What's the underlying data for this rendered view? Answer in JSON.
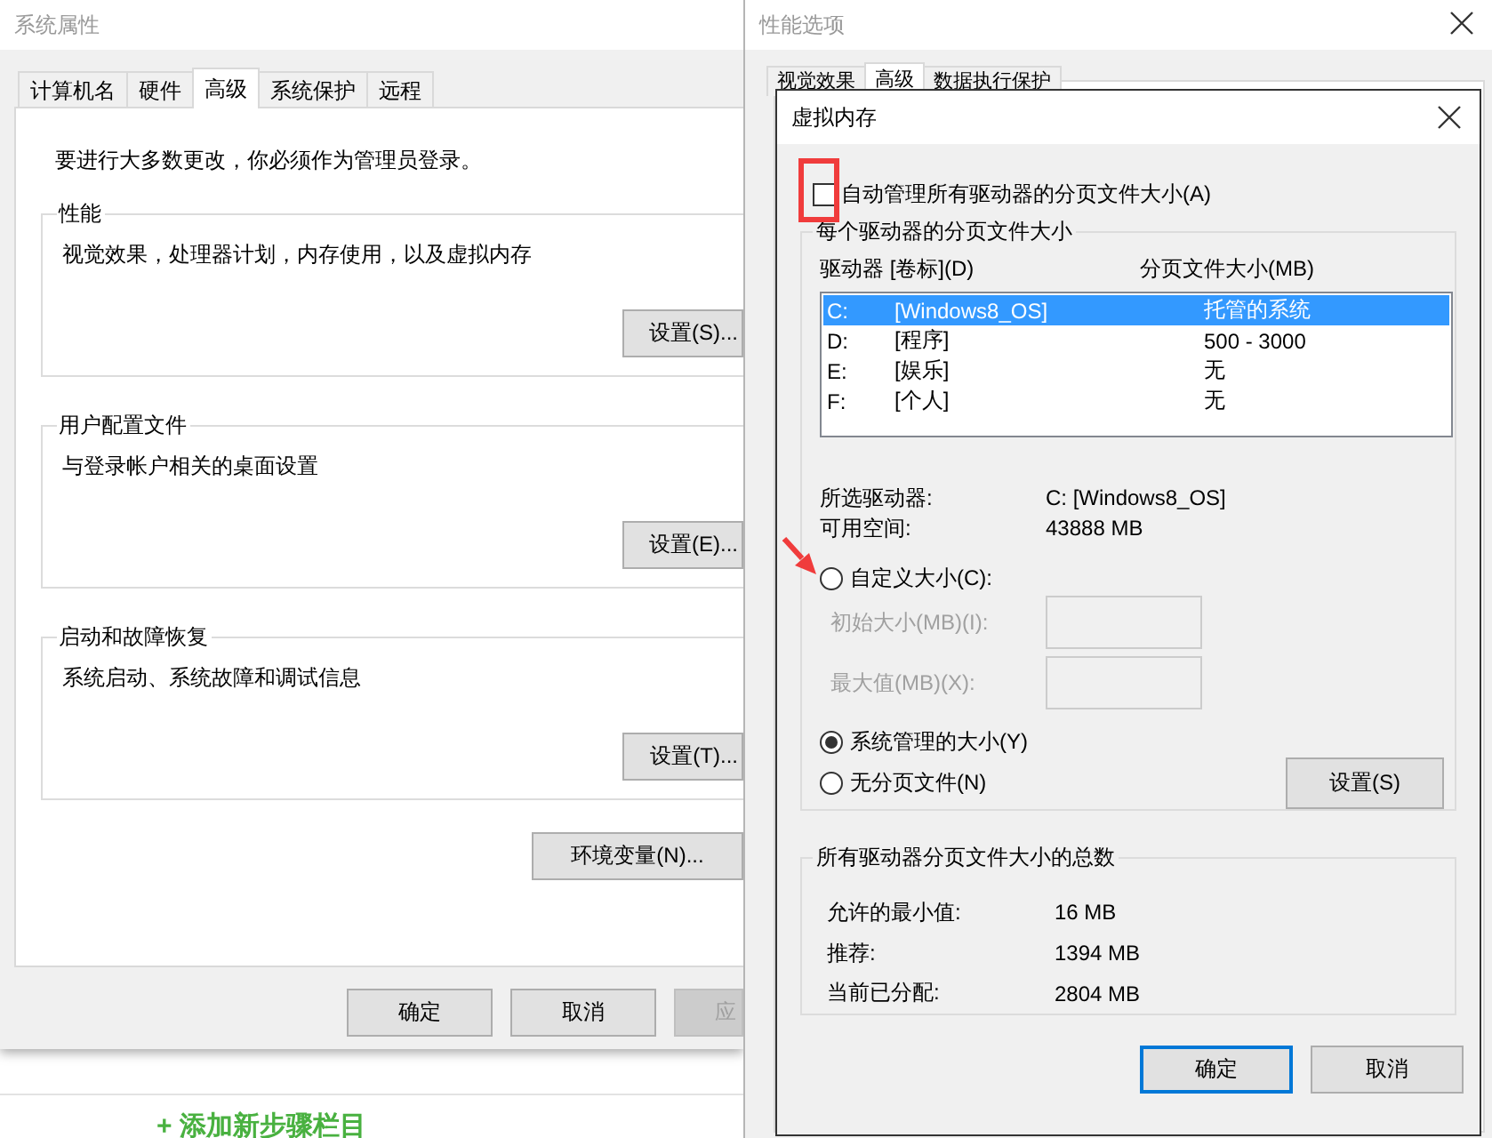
{
  "system_properties": {
    "title": "系统属性",
    "tabs": [
      {
        "label": "计算机名",
        "selected": false
      },
      {
        "label": "硬件",
        "selected": false
      },
      {
        "label": "高级",
        "selected": true
      },
      {
        "label": "系统保护",
        "selected": false
      },
      {
        "label": "远程",
        "selected": false
      }
    ],
    "notice": "要进行大多数更改，你必须作为管理员登录。",
    "groups": [
      {
        "title": "性能",
        "description": "视觉效果，处理器计划，内存使用，以及虚拟内存",
        "button": "设置(S)..."
      },
      {
        "title": "用户配置文件",
        "description": "与登录帐户相关的桌面设置",
        "button": "设置(E)..."
      },
      {
        "title": "启动和故障恢复",
        "description": "系统启动、系统故障和调试信息",
        "button": "设置(T)..."
      }
    ],
    "env_button": "环境变量(N)...",
    "buttons": [
      {
        "label": "确定",
        "disabled": false
      },
      {
        "label": "取消",
        "disabled": false
      },
      {
        "label": "应",
        "disabled": true
      }
    ]
  },
  "page": {
    "add_step": "+ 添加新步骤栏目"
  },
  "performance_options": {
    "title": "性能选项",
    "tabs": [
      {
        "label": "视觉效果",
        "selected": false
      },
      {
        "label": "高级",
        "selected": true
      },
      {
        "label": "数据执行保护",
        "selected": false
      }
    ]
  },
  "virtual_memory": {
    "title": "虚拟内存",
    "auto_manage": {
      "label": "自动管理所有驱动器的分页文件大小(A)",
      "checked": false
    },
    "per_drive_title": "每个驱动器的分页文件大小",
    "columns": [
      "驱动器 [卷标](D)",
      "分页文件大小(MB)"
    ],
    "drives": [
      {
        "drive": "C:",
        "volume": "[Windows8_OS]",
        "size": "托管的系统",
        "selected": true
      },
      {
        "drive": "D:",
        "volume": "[程序]",
        "size": "500 - 3000",
        "selected": false
      },
      {
        "drive": "E:",
        "volume": "[娱乐]",
        "size": "无",
        "selected": false
      },
      {
        "drive": "F:",
        "volume": "[个人]",
        "size": "无",
        "selected": false
      }
    ],
    "info": [
      {
        "label": "所选驱动器:",
        "value": "C:  [Windows8_OS]"
      },
      {
        "label": "可用空间:",
        "value": "43888 MB"
      }
    ],
    "custom_size": {
      "label": "自定义大小(C):",
      "selected": false
    },
    "fields": [
      {
        "label": "初始大小(MB)(I):",
        "disabled": true
      },
      {
        "label": "最大值(MB)(X):",
        "disabled": true
      }
    ],
    "system_managed": {
      "label": "系统管理的大小(Y)",
      "selected": true
    },
    "no_paging": {
      "label": "无分页文件(N)",
      "selected": false
    },
    "set_button": "设置(S)",
    "totals_title": "所有驱动器分页文件大小的总数",
    "totals": [
      {
        "label": "允许的最小值:",
        "value": "16 MB"
      },
      {
        "label": "推荐:",
        "value": "1394 MB"
      },
      {
        "label": "当前已分配:",
        "value": "2804 MB"
      }
    ],
    "buttons": [
      {
        "label": "确定",
        "default": true
      },
      {
        "label": "取消",
        "default": false
      }
    ]
  }
}
